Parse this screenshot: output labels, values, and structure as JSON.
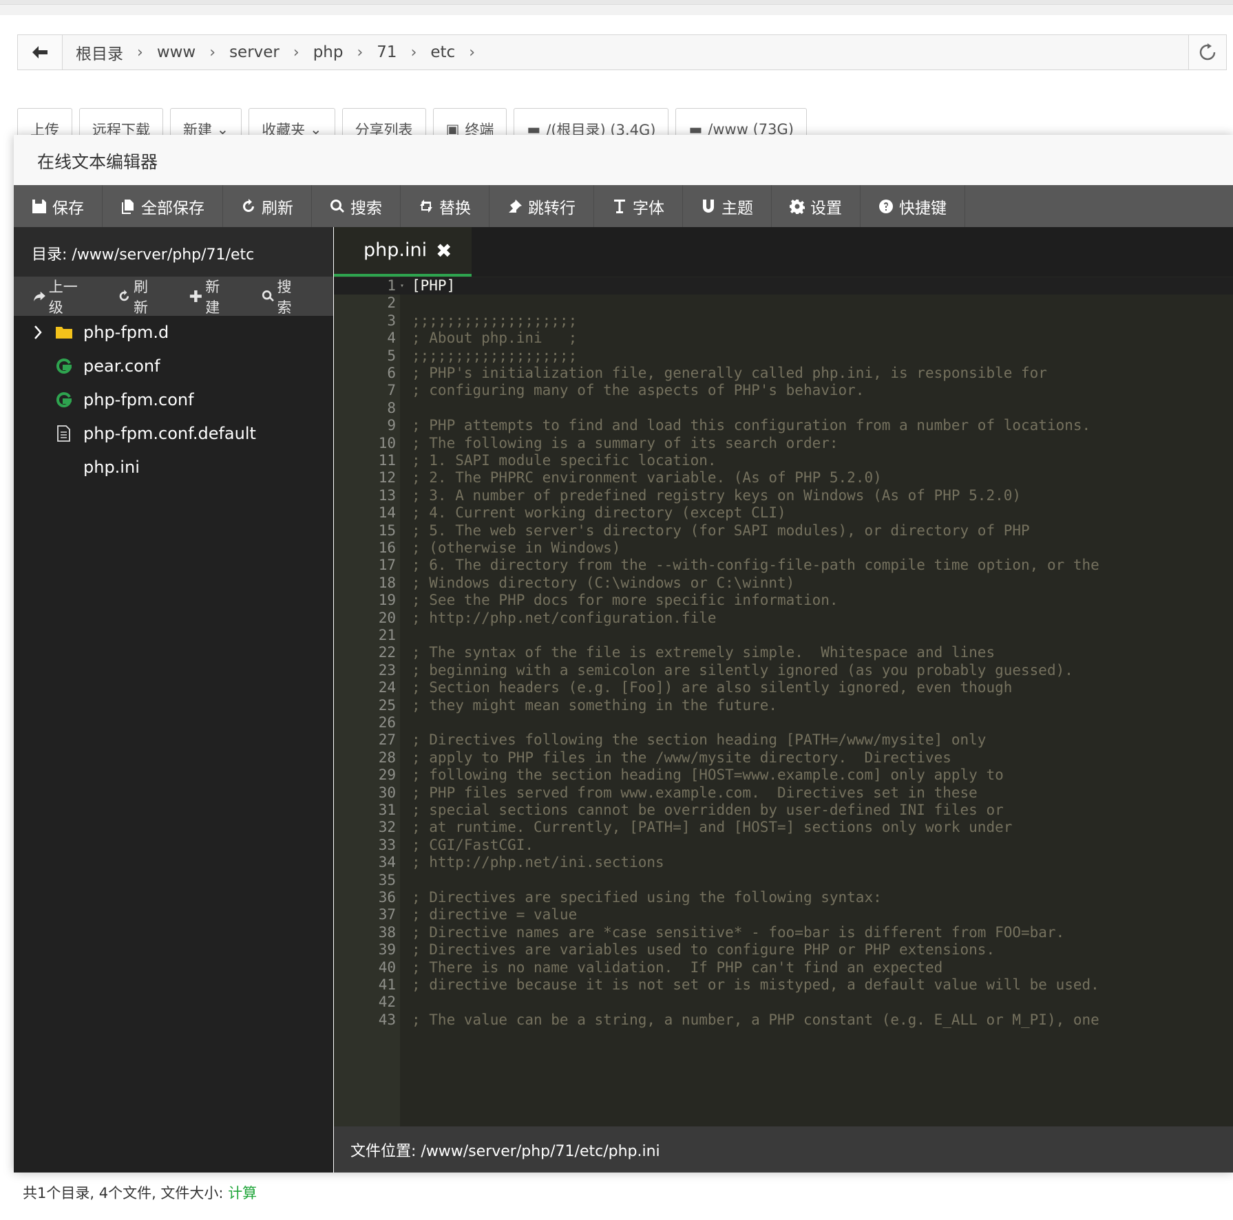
{
  "breadcrumb": {
    "items": [
      "根目录",
      "www",
      "server",
      "php",
      "71",
      "etc"
    ]
  },
  "page_toolbar": {
    "buttons": [
      "上传",
      "远程下载",
      "新建",
      "收藏夹",
      "分享列表",
      "终端",
      "/(根目录) (3.4G)",
      "/www (73G)"
    ]
  },
  "editor": {
    "title": "在线文本编辑器",
    "toolbar": {
      "save": "保存",
      "save_all": "全部保存",
      "refresh": "刷新",
      "search": "搜索",
      "replace": "替换",
      "goto_line": "跳转行",
      "font": "字体",
      "theme": "主题",
      "settings": "设置",
      "shortcuts": "快捷键"
    },
    "sidebar": {
      "directory": "目录: /www/server/php/71/etc",
      "tools": {
        "up": "上一级",
        "refresh": "刷新",
        "new": "新建",
        "search": "搜索"
      },
      "files": [
        "php-fpm.d",
        "pear.conf",
        "php-fpm.conf",
        "php-fpm.conf.default",
        "php.ini"
      ]
    },
    "tab": {
      "name": "php.ini",
      "close": "✖"
    },
    "lines": [
      "[PHP]",
      "",
      ";;;;;;;;;;;;;;;;;;;",
      "; About php.ini   ;",
      ";;;;;;;;;;;;;;;;;;;",
      "; PHP's initialization file, generally called php.ini, is responsible for",
      "; configuring many of the aspects of PHP's behavior.",
      "",
      "; PHP attempts to find and load this configuration from a number of locations.",
      "; The following is a summary of its search order:",
      "; 1. SAPI module specific location.",
      "; 2. The PHPRC environment variable. (As of PHP 5.2.0)",
      "; 3. A number of predefined registry keys on Windows (As of PHP 5.2.0)",
      "; 4. Current working directory (except CLI)",
      "; 5. The web server's directory (for SAPI modules), or directory of PHP",
      "; (otherwise in Windows)",
      "; 6. The directory from the --with-config-file-path compile time option, or the",
      "; Windows directory (C:\\windows or C:\\winnt)",
      "; See the PHP docs for more specific information.",
      "; http://php.net/configuration.file",
      "",
      "; The syntax of the file is extremely simple.  Whitespace and lines",
      "; beginning with a semicolon are silently ignored (as you probably guessed).",
      "; Section headers (e.g. [Foo]) are also silently ignored, even though",
      "; they might mean something in the future.",
      "",
      "; Directives following the section heading [PATH=/www/mysite] only",
      "; apply to PHP files in the /www/mysite directory.  Directives",
      "; following the section heading [HOST=www.example.com] only apply to",
      "; PHP files served from www.example.com.  Directives set in these",
      "; special sections cannot be overridden by user-defined INI files or",
      "; at runtime. Currently, [PATH=] and [HOST=] sections only work under",
      "; CGI/FastCGI.",
      "; http://php.net/ini.sections",
      "",
      "; Directives are specified using the following syntax:",
      "; directive = value",
      "; Directive names are *case sensitive* - foo=bar is different from FOO=bar.",
      "; Directives are variables used to configure PHP or PHP extensions.",
      "; There is no name validation.  If PHP can't find an expected",
      "; directive because it is not set or is mistyped, a default value will be used.",
      "",
      "; The value can be a string, a number, a PHP constant (e.g. E_ALL or M_PI), one"
    ],
    "status": "文件位置: /www/server/php/71/etc/php.ini"
  },
  "footer": {
    "summary": "共1个目录, 4个文件, 文件大小: ",
    "calc_link": "计算"
  },
  "colors": {
    "accent_green": "#20a53a",
    "toolbar_bg": "#585858",
    "editor_bg": "#272822",
    "comment": "#75715e"
  }
}
